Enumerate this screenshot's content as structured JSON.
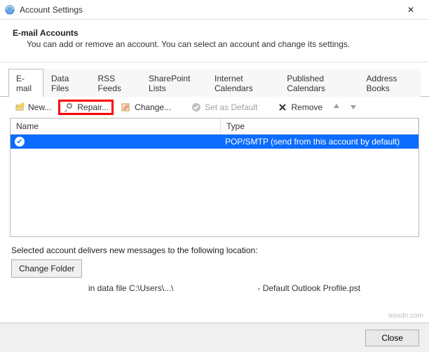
{
  "window": {
    "title": "Account Settings",
    "close_glyph": "✕"
  },
  "header": {
    "heading": "E-mail Accounts",
    "subtext": "You can add or remove an account. You can select an account and change its settings."
  },
  "tabs": [
    {
      "label": "E-mail",
      "active": true
    },
    {
      "label": "Data Files",
      "active": false
    },
    {
      "label": "RSS Feeds",
      "active": false
    },
    {
      "label": "SharePoint Lists",
      "active": false
    },
    {
      "label": "Internet Calendars",
      "active": false
    },
    {
      "label": "Published Calendars",
      "active": false
    },
    {
      "label": "Address Books",
      "active": false
    }
  ],
  "toolbar": {
    "new": "New...",
    "repair": "Repair...",
    "change": "Change...",
    "set_default": "Set as Default",
    "remove": "Remove"
  },
  "grid": {
    "cols": {
      "name": "Name",
      "type": "Type"
    },
    "rows": [
      {
        "name": "",
        "type": "POP/SMTP (send from this account by default)"
      }
    ]
  },
  "lower": {
    "delivers_text": "Selected account delivers new messages to the following location:",
    "change_folder": "Change Folder",
    "datafile_left": "in data file C:\\Users\\...\\",
    "datafile_right": "- Default Outlook Profile.pst"
  },
  "footer": {
    "close": "Close"
  },
  "watermark": "wsxdn.com"
}
